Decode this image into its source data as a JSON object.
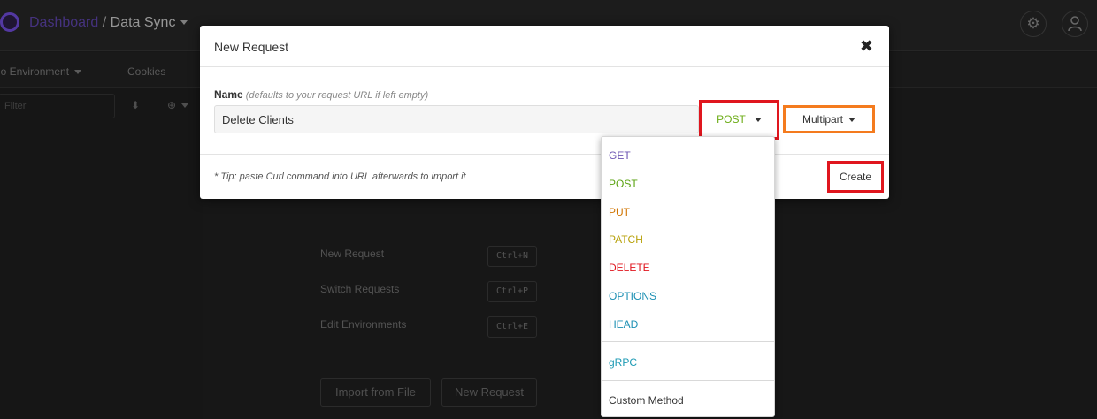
{
  "app": {
    "breadcrumb_root": "Dashboard",
    "breadcrumb_sep": "/",
    "workspace": "Data Sync",
    "environment": "No Environment",
    "cookies": "Cookies",
    "filter_placeholder": "Filter",
    "settings_icon": "gear-icon",
    "account_icon": "user-icon"
  },
  "empty_state": {
    "shortcuts": [
      {
        "label": "New Request",
        "keys": "Ctrl+N"
      },
      {
        "label": "Switch Requests",
        "keys": "Ctrl+P"
      },
      {
        "label": "Edit Environments",
        "keys": "Ctrl+E"
      }
    ],
    "import_button": "Import from File",
    "new_request_button": "New Request"
  },
  "modal": {
    "title": "New Request",
    "close_glyph": "✖",
    "name_label": "Name",
    "name_hint": "(defaults to your request URL if left empty)",
    "name_value": "Delete Clients",
    "method": "POST",
    "body_type": "Multipart",
    "tip": "* Tip: paste Curl command into URL afterwards to import it",
    "create_label": "Create"
  },
  "method_dropdown": {
    "methods": [
      {
        "label": "GET",
        "color": "#6d55b3"
      },
      {
        "label": "POST",
        "color": "#59a210"
      },
      {
        "label": "PUT",
        "color": "#d07502"
      },
      {
        "label": "PATCH",
        "color": "#b8a20c"
      },
      {
        "label": "DELETE",
        "color": "#e0161e"
      },
      {
        "label": "OPTIONS",
        "color": "#1c90b4"
      },
      {
        "label": "HEAD",
        "color": "#1c90b4"
      }
    ],
    "grpc": {
      "label": "gRPC",
      "color": "#1c9ab4"
    },
    "custom": {
      "label": "Custom Method",
      "color": "#333333"
    }
  },
  "highlight_colors": {
    "method_and_create": "#e0161e",
    "body_type": "#f47b1e"
  }
}
